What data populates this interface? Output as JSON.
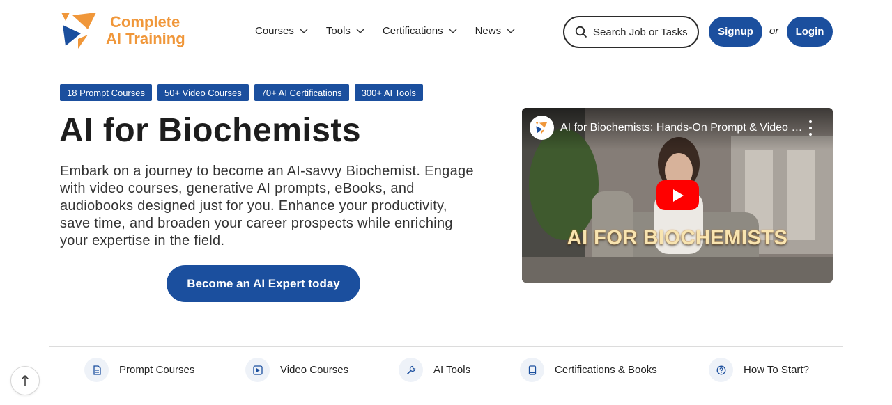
{
  "brand": {
    "line1": "Complete",
    "line2": "AI Training",
    "accent_color": "#f0973a",
    "primary_color": "#1b4f9e"
  },
  "nav": {
    "items": [
      {
        "label": "Courses",
        "icon": "chevron-down-icon"
      },
      {
        "label": "Tools",
        "icon": "chevron-down-icon"
      },
      {
        "label": "Certifications",
        "icon": "chevron-down-icon"
      },
      {
        "label": "News",
        "icon": "chevron-down-icon"
      }
    ]
  },
  "header": {
    "search_label": "Search Job or Tasks",
    "signup_label": "Signup",
    "or_label": "or",
    "login_label": "Login"
  },
  "badges": [
    "18 Prompt Courses",
    "50+ Video Courses",
    "70+ AI Certifications",
    "300+ AI Tools"
  ],
  "hero": {
    "title": "AI for Biochemists",
    "description": "Embark on a journey to become an AI-savvy Biochemist. Engage with video courses, generative AI prompts, eBooks, and audiobooks designed just for you. Enhance your productivity, save time, and broaden your career prospects while enriching your expertise in the field.",
    "cta_label": "Become an AI Expert today"
  },
  "video": {
    "title": "AI for Biochemists: Hands-On Prompt & Video Courses",
    "overlay_text": "AI FOR BIOCHEMISTS",
    "play_color": "#ff0000"
  },
  "bottom_nav": [
    {
      "label": "Prompt Courses",
      "icon": "document-icon"
    },
    {
      "label": "Video Courses",
      "icon": "video-play-icon"
    },
    {
      "label": "AI Tools",
      "icon": "wrench-icon"
    },
    {
      "label": "Certifications & Books",
      "icon": "book-icon"
    },
    {
      "label": "How To Start?",
      "icon": "question-icon"
    }
  ]
}
